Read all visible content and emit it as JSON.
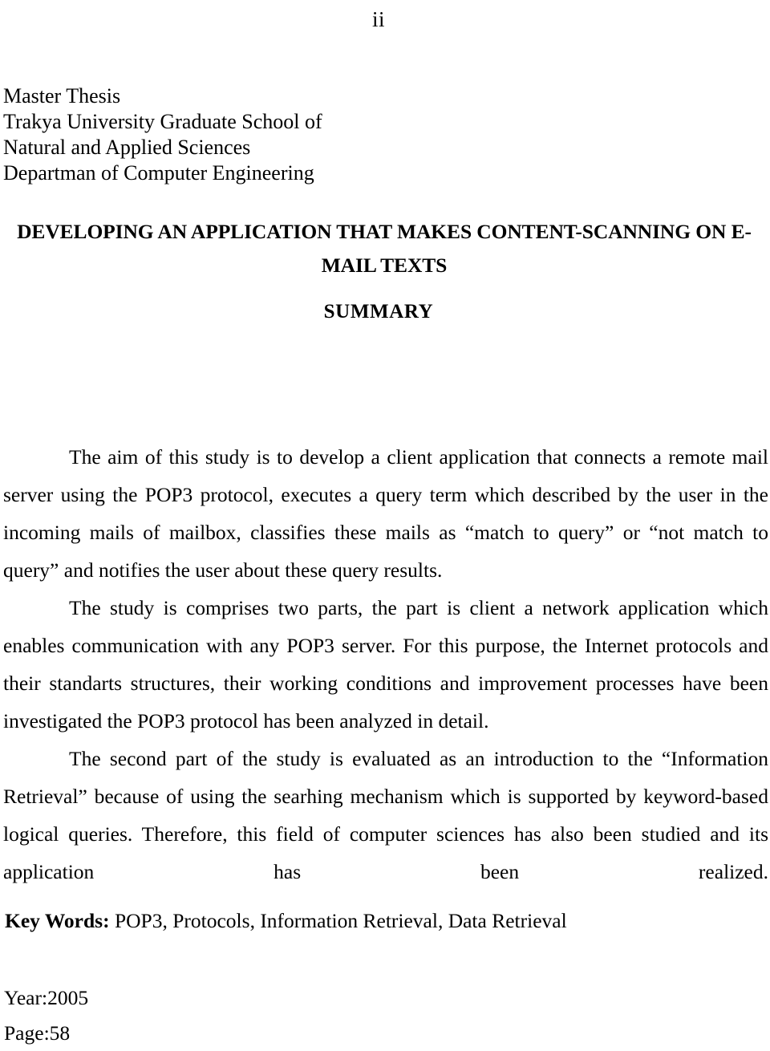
{
  "page": {
    "folio": "ii"
  },
  "thesis_block": {
    "lines": [
      "Master Thesis",
      "Trakya University Graduate School of",
      "Natural and Applied Sciences",
      "Departman of Computer Engineering"
    ]
  },
  "title": "DEVELOPING AN APPLICATION THAT MAKES CONTENT-SCANNING ON E-MAIL TEXTS",
  "section_heading": "SUMMARY",
  "abstract": {
    "paragraphs": [
      "The aim of this study is to develop  a client application that connects a remote mail server using the POP3 protocol, executes  a query term which described by the user in the incoming mails of mailbox,  classifies these  mails as “match to query” or “not match  to query” and notifies the user about these query results.",
      "The study is comprises two  parts, the part  is client a network application which enables communication with any POP3 server. For this purpose,  the Internet protocols and their standarts structures, their  working conditions and  improvement processes have been investigated the POP3 protocol has been analyzed in detail.",
      "The second part of the study is evaluated as an introduction to the “Information Retrieval” because of using the searhing mechanism which is supported by keyword-based logical queries. Therefore, this field of computer sciences has also been studied and its application has been realized."
    ]
  },
  "keywords": {
    "label": "Key Words:",
    "value": " POP3,  Protocols,  Information Retrieval, Data Retrieval"
  },
  "meta": {
    "year_line": "Year:2005",
    "page_line": "Page:58"
  }
}
